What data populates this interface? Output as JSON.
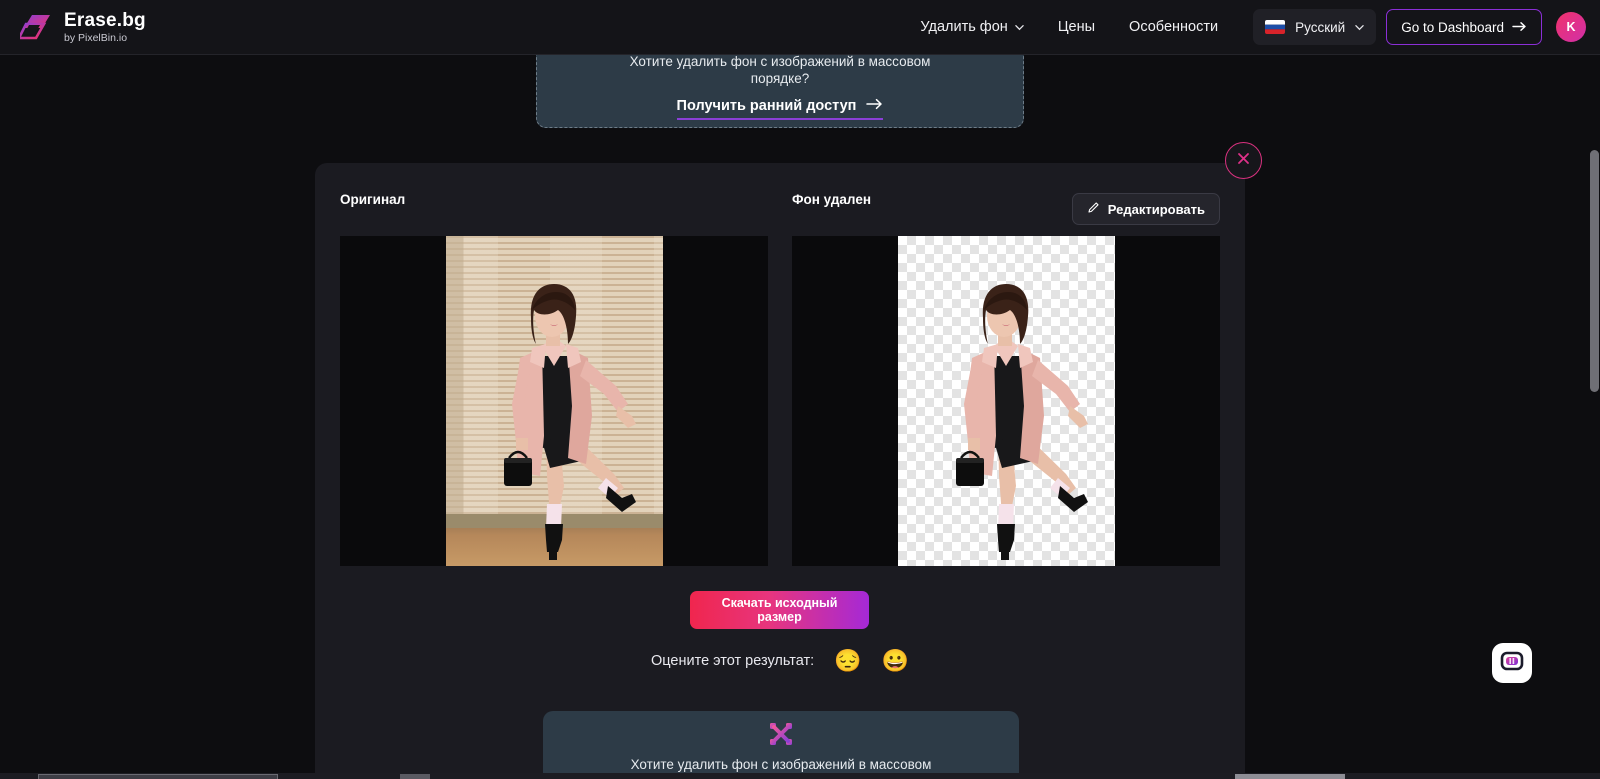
{
  "header": {
    "brand_name": "Erase.bg",
    "brand_sub": "by PixelBin.io",
    "brand_logo_icon": "erasebg-logo-icon",
    "nav": [
      {
        "label": "Удалить фон",
        "has_caret": true,
        "caret_icon": "chevron-down-icon"
      },
      {
        "label": "Цены",
        "has_caret": false
      },
      {
        "label": "Особенности",
        "has_caret": false
      }
    ],
    "language": {
      "label": "Русский",
      "flag_icon": "flag-russia-icon",
      "caret_icon": "chevron-down-icon"
    },
    "dashboard_button": {
      "label": "Go to Dashboard",
      "arrow_icon": "arrow-right-icon",
      "border_color": "#8b2fd6"
    },
    "avatar": {
      "initial": "K",
      "color": "#f0326b"
    }
  },
  "promo_top": {
    "text": "Хотите удалить фон с изображений в массовом порядке?",
    "cta_label": "Получить ранний доступ",
    "cta_arrow_icon": "arrow-right-icon",
    "background": "#2d3b47",
    "underline_color": "#8b3fd6"
  },
  "panel": {
    "label_original": "Оригинал",
    "label_removed": "Фон удален",
    "edit_button": {
      "label": "Редактировать",
      "icon": "pencil-icon"
    },
    "close_button": {
      "icon": "close-icon",
      "color": "#d9317f"
    },
    "download_button": {
      "line1": "Скачать исходный",
      "line2": "размер",
      "gradient_from": "#f0264e",
      "gradient_to": "#a529d6"
    },
    "rating": {
      "label": "Оцените этот результат:",
      "options": [
        {
          "name": "pensive-face-emoji",
          "glyph": "😔"
        },
        {
          "name": "grinning-face-emoji",
          "glyph": "😀"
        }
      ]
    }
  },
  "promo_bottom": {
    "icon": "pixelbin-x-icon",
    "text": "Хотите удалить фон с изображений в массовом",
    "background": "#2d3b47"
  },
  "chat_widget": {
    "icon": "chat-bubble-icon"
  },
  "scrollbar": {
    "thumb_color": "#6f6f75"
  }
}
